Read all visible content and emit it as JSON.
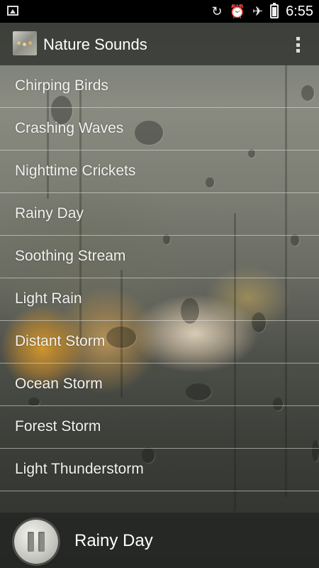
{
  "status_bar": {
    "time": "6:55",
    "icons": [
      "image-icon",
      "rotate-icon",
      "alarm-icon",
      "airplane-icon",
      "battery-icon"
    ]
  },
  "app_bar": {
    "title": "Nature Sounds",
    "icon": "app-icon",
    "menu_icon": "overflow-menu-icon"
  },
  "sounds": [
    "Chirping Birds",
    "Crashing Waves",
    "Nighttime Crickets",
    "Rainy Day",
    "Soothing Stream",
    "Light Rain",
    "Distant Storm",
    "Ocean Storm",
    "Forest Storm",
    "Light Thunderstorm"
  ],
  "player": {
    "now_playing": "Rainy Day",
    "control_icon": "pause-icon"
  },
  "colors": {
    "status_bar": "#000000",
    "text": "#f2f2ee",
    "divider": "#e6e6e1"
  }
}
